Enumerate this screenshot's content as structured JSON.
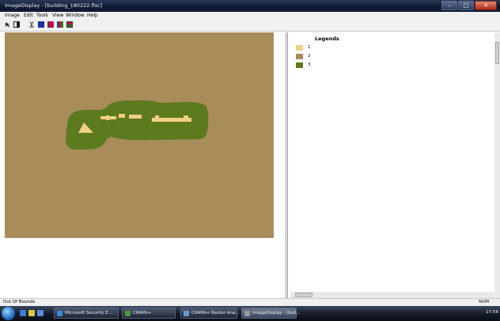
{
  "window": {
    "title": "ImageDisplay - [building_180222.flsc]"
  },
  "menu": [
    "Image",
    "Edit",
    "Tools",
    "View",
    "Window",
    "Help"
  ],
  "toolbar_icons": [
    "pointer-icon",
    "select-icon",
    "cut-icon",
    "color-square-blue-icon",
    "color-square-red-icon",
    "color-bars-icon",
    "stack-icon"
  ],
  "legend": {
    "title": "Legends",
    "items": [
      {
        "label": "1",
        "color": "#f2cf84"
      },
      {
        "label": "2",
        "color": "#a88c5a"
      },
      {
        "label": "3",
        "color": "#5c7a1e"
      }
    ]
  },
  "status": {
    "left": "Out Of Bounds",
    "right": "NUM"
  },
  "taskbar": {
    "items": [
      {
        "label": "Microsoft Security E...",
        "icon_color": "#3a8ad8"
      },
      {
        "label": "CRAMs+",
        "icon_color": "#4a9a3a"
      },
      {
        "label": "CRAMs+ Raster Ana...",
        "icon_color": "#6a9ad0"
      },
      {
        "label": "ImageDisplay - [buil...",
        "icon_color": "#9a9a9a"
      }
    ],
    "clock": "17:56"
  },
  "colors": {
    "background_class": "#a88c5a",
    "buffer_class": "#5c7a1e",
    "building_class": "#f2cf84"
  }
}
